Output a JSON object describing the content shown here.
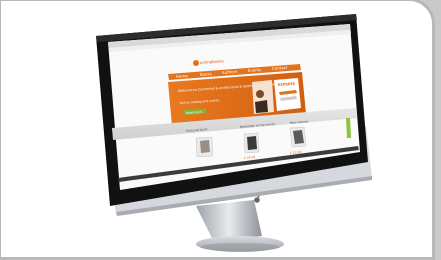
{
  "site": {
    "logo": "onlinebooks",
    "nav_items": [
      "Home",
      "Books",
      "Authors",
      "Events",
      "Contact"
    ],
    "hero_heading": "Welcome to Connected & professional & Sparkly professional Bookstore",
    "hero_subtext": "Online catalog and events",
    "hero_button": "Read more",
    "hero_badge": "EXPRESS",
    "sections": [
      {
        "title": "Featured book",
        "price": ""
      },
      {
        "title": "Bestseller of the month",
        "price": "€ 24.95"
      },
      {
        "title": "New release",
        "price": "€ 19.50"
      }
    ],
    "footer": "Footer links"
  },
  "colors": {
    "accent": "#e2731c",
    "bezel": "#111111",
    "stand": "#c8ccd0"
  },
  "icons": {
    "apple_logo": "apple-icon"
  }
}
